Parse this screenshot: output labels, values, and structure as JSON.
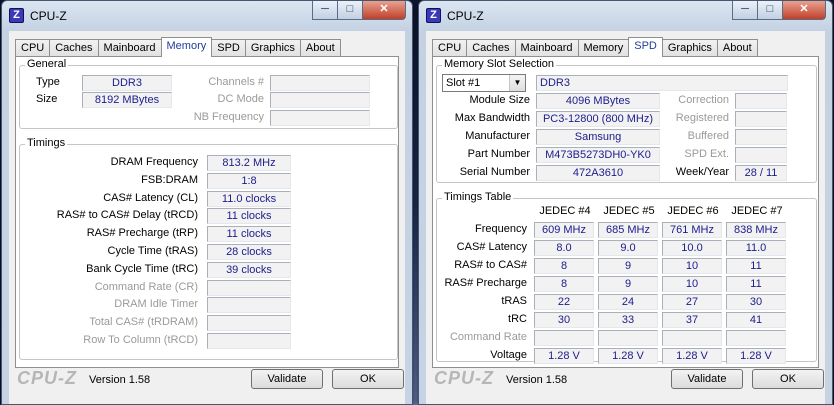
{
  "left_window": {
    "title": "CPU-Z",
    "controls": {
      "minimize": "─",
      "maximize": "□",
      "close": "✕"
    },
    "tabs": [
      "CPU",
      "Caches",
      "Mainboard",
      "Memory",
      "SPD",
      "Graphics",
      "About"
    ],
    "active_tab": "Memory",
    "general": {
      "legend": "General",
      "type_label": "Type",
      "type_value": "DDR3",
      "size_label": "Size",
      "size_value": "8192 MBytes",
      "channels_label": "Channels #",
      "channels_value": "",
      "dc_mode_label": "DC Mode",
      "dc_mode_value": "",
      "nb_frequency_label": "NB Frequency",
      "nb_frequency_value": ""
    },
    "timings": {
      "legend": "Timings",
      "rows": [
        {
          "label": "DRAM Frequency",
          "value": "813.2 MHz",
          "enabled": true
        },
        {
          "label": "FSB:DRAM",
          "value": "1:8",
          "enabled": true
        },
        {
          "label": "CAS# Latency (CL)",
          "value": "11.0 clocks",
          "enabled": true
        },
        {
          "label": "RAS# to CAS# Delay (tRCD)",
          "value": "11 clocks",
          "enabled": true
        },
        {
          "label": "RAS# Precharge (tRP)",
          "value": "11 clocks",
          "enabled": true
        },
        {
          "label": "Cycle Time (tRAS)",
          "value": "28 clocks",
          "enabled": true
        },
        {
          "label": "Bank Cycle Time (tRC)",
          "value": "39 clocks",
          "enabled": true
        },
        {
          "label": "Command Rate (CR)",
          "value": "",
          "enabled": false
        },
        {
          "label": "DRAM Idle Timer",
          "value": "",
          "enabled": false
        },
        {
          "label": "Total CAS# (tRDRAM)",
          "value": "",
          "enabled": false
        },
        {
          "label": "Row To Column (tRCD)",
          "value": "",
          "enabled": false
        }
      ]
    },
    "footer": {
      "brand": "CPU-Z",
      "version": "Version 1.58",
      "validate": "Validate",
      "ok": "OK"
    }
  },
  "right_window": {
    "title": "CPU-Z",
    "controls": {
      "minimize": "─",
      "maximize": "□",
      "close": "✕"
    },
    "tabs": [
      "CPU",
      "Caches",
      "Mainboard",
      "Memory",
      "SPD",
      "Graphics",
      "About"
    ],
    "active_tab": "SPD",
    "slot_selection": {
      "legend": "Memory Slot Selection",
      "slot_value": "Slot #1",
      "slot_type": "DDR3",
      "module_size_label": "Module Size",
      "module_size_value": "4096 MBytes",
      "max_bandwidth_label": "Max Bandwidth",
      "max_bandwidth_value": "PC3-12800 (800 MHz)",
      "manufacturer_label": "Manufacturer",
      "manufacturer_value": "Samsung",
      "part_number_label": "Part Number",
      "part_number_value": "M473B5273DH0-YK0",
      "serial_number_label": "Serial Number",
      "serial_number_value": "472A3610",
      "correction_label": "Correction",
      "registered_label": "Registered",
      "buffered_label": "Buffered",
      "spd_ext_label": "SPD Ext.",
      "week_year_label": "Week/Year",
      "week_year_value": "28 / 11"
    },
    "timings_table": {
      "legend": "Timings Table",
      "columns": [
        "JEDEC #4",
        "JEDEC #5",
        "JEDEC #6",
        "JEDEC #7"
      ],
      "rows": [
        {
          "label": "Frequency",
          "values": [
            "609 MHz",
            "685 MHz",
            "761 MHz",
            "838 MHz"
          ],
          "enabled": true
        },
        {
          "label": "CAS# Latency",
          "values": [
            "8.0",
            "9.0",
            "10.0",
            "11.0"
          ],
          "enabled": true
        },
        {
          "label": "RAS# to CAS#",
          "values": [
            "8",
            "9",
            "10",
            "11"
          ],
          "enabled": true
        },
        {
          "label": "RAS# Precharge",
          "values": [
            "8",
            "9",
            "10",
            "11"
          ],
          "enabled": true
        },
        {
          "label": "tRAS",
          "values": [
            "22",
            "24",
            "27",
            "30"
          ],
          "enabled": true
        },
        {
          "label": "tRC",
          "values": [
            "30",
            "33",
            "37",
            "41"
          ],
          "enabled": true
        },
        {
          "label": "Command Rate",
          "values": [
            "",
            "",
            "",
            ""
          ],
          "enabled": false
        },
        {
          "label": "Voltage",
          "values": [
            "1.28 V",
            "1.28 V",
            "1.28 V",
            "1.28 V"
          ],
          "enabled": true
        }
      ]
    },
    "footer": {
      "brand": "CPU-Z",
      "version": "Version 1.58",
      "validate": "Validate",
      "ok": "OK"
    }
  },
  "colors": {
    "value_text": "#1c1c8c",
    "active_tab_text": "#1f3e9a",
    "disabled_label": "#9a9a9a"
  }
}
